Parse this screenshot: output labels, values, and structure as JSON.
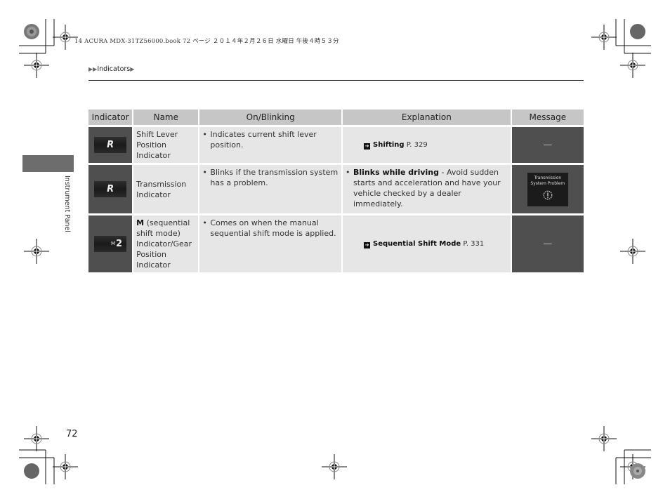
{
  "print_header": "14 ACURA MDX-31TZ56000.book  72 ページ  ２０１４年２月２６日  水曜日  午後４時５３分",
  "breadcrumb": {
    "prefix": "▶▶",
    "label": "Indicators",
    "suffix": "▶"
  },
  "side_tab": {
    "label": "Instrument Panel"
  },
  "page_number": "72",
  "table": {
    "headers": [
      "Indicator",
      "Name",
      "On/Blinking",
      "Explanation",
      "Message"
    ],
    "rows": [
      {
        "indicator_icon": "shift-lever-position-icon",
        "indicator_glyph": "R",
        "name": "Shift Lever Position Indicator",
        "on_blinking": "Indicates current shift lever position.",
        "explanation_ref_title": "Shifting",
        "explanation_ref_page": "P. 329",
        "message": "—"
      },
      {
        "indicator_icon": "transmission-indicator-icon",
        "indicator_glyph": "R",
        "name": "Transmission Indicator",
        "on_blinking": "Blinks if the transmission system has a problem.",
        "explanation_bold": "Blinks while driving",
        "explanation_text": " - Avoid sudden starts and acceleration and have your vehicle checked by a dealer immediately.",
        "message_line1": "Transmission",
        "message_line2": "System Problem",
        "message_icon": "transmission-warning-gear-icon"
      },
      {
        "indicator_icon": "sequential-shift-mode-icon",
        "indicator_glyph_small": "M",
        "indicator_glyph": "2",
        "name_bold": "M",
        "name_text": " (sequential shift mode) Indicator/Gear Position Indicator",
        "on_blinking": "Comes on when the manual sequential shift mode is applied.",
        "explanation_ref_title": "Sequential Shift Mode",
        "explanation_ref_page": "P. 331",
        "message": "—"
      }
    ]
  }
}
